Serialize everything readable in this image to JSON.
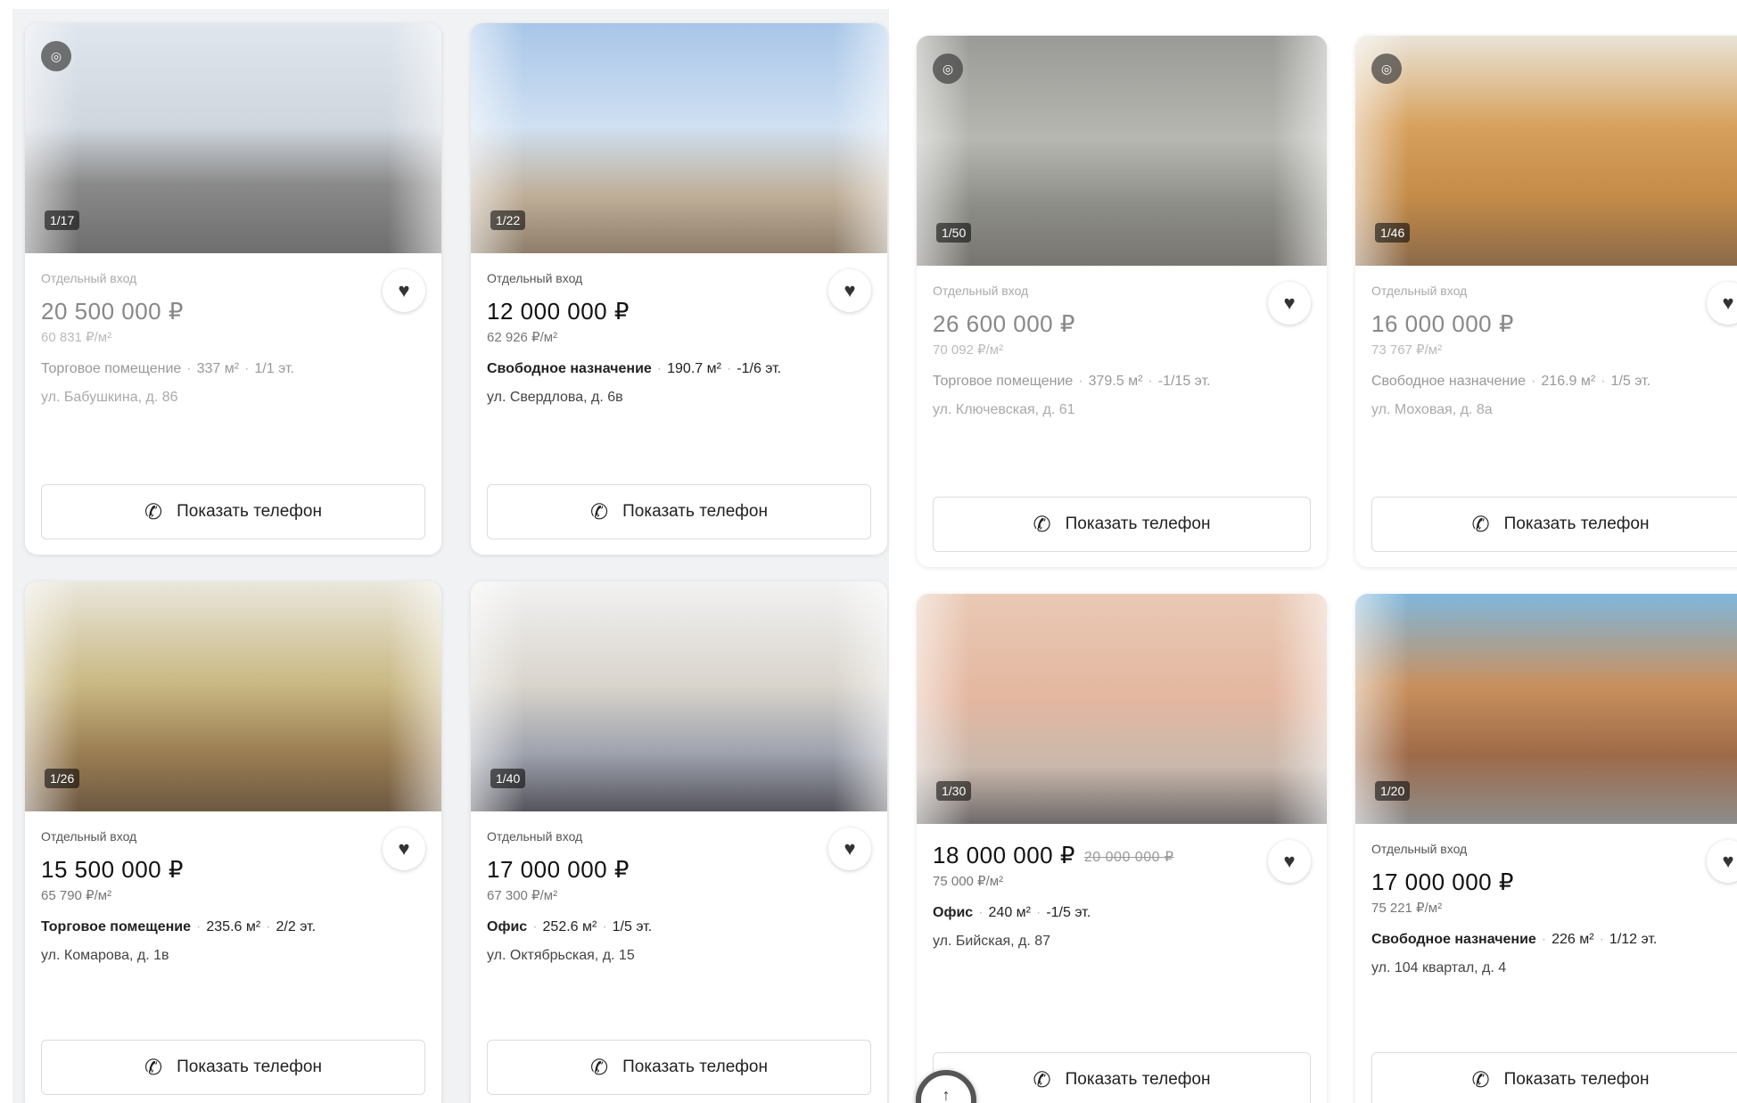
{
  "listings": [
    {
      "counter": "1/17",
      "tag": "Отдельный вход",
      "price": "20 500 000 ₽",
      "old_price": "",
      "ppm": "60 831 ₽/м²",
      "type": "Торговое помещение",
      "area": "337 м²",
      "floor": "1/1 эт.",
      "address": "ул. Бабушкина, д. 86",
      "phone": "Показать телефон"
    },
    {
      "counter": "1/22",
      "tag": "Отдельный вход",
      "price": "12 000 000 ₽",
      "old_price": "",
      "ppm": "62 926 ₽/м²",
      "type": "Свободное назначение",
      "area": "190.7 м²",
      "floor": "-1/6 эт.",
      "address": "ул. Свердлова, д. 6в",
      "phone": "Показать телефон"
    },
    {
      "counter": "1/50",
      "tag": "Отдельный вход",
      "price": "26 600 000 ₽",
      "old_price": "",
      "ppm": "70 092 ₽/м²",
      "type": "Торговое помещение",
      "area": "379.5 м²",
      "floor": "-1/15 эт.",
      "address": "ул. Ключевская, д. 61",
      "phone": "Показать телефон"
    },
    {
      "counter": "1/46",
      "tag": "Отдельный вход",
      "price": "16 000 000 ₽",
      "old_price": "",
      "ppm": "73 767 ₽/м²",
      "type": "Свободное назначение",
      "area": "216.9 м²",
      "floor": "1/5 эт.",
      "address": "ул. Моховая, д. 8а",
      "phone": "Показать телефон"
    },
    {
      "counter": "1/26",
      "tag": "Отдельный вход",
      "price": "15 500 000 ₽",
      "old_price": "",
      "ppm": "65 790 ₽/м²",
      "type": "Торговое помещение",
      "area": "235.6 м²",
      "floor": "2/2 эт.",
      "address": "ул. Комарова, д. 1в",
      "phone": "Показать телефон"
    },
    {
      "counter": "1/40",
      "tag": "Отдельный вход",
      "price": "17 000 000 ₽",
      "old_price": "",
      "ppm": "67 300 ₽/м²",
      "type": "Офис",
      "area": "252.6 м²",
      "floor": "1/5 эт.",
      "address": "ул. Октябрьская, д. 15",
      "phone": "Показать телефон"
    },
    {
      "counter": "1/30",
      "tag": "",
      "price": "18 000 000 ₽",
      "old_price": "20 000 000 ₽",
      "ppm": "75 000 ₽/м²",
      "type": "Офис",
      "area": "240 м²",
      "floor": "-1/5 эт.",
      "address": "ул. Бийская, д. 87",
      "phone": "Показать телефон"
    },
    {
      "counter": "1/20",
      "tag": "Отдельный вход",
      "price": "17 000 000 ₽",
      "old_price": "",
      "ppm": "75 221 ₽/м²",
      "type": "Свободное назначение",
      "area": "226 м²",
      "floor": "1/12 эт.",
      "address": "ул. 104 квартал, д. 4",
      "phone": "Показать телефон"
    }
  ],
  "icons": {
    "favorite": "heart-icon",
    "phone": "phone-icon",
    "panorama": "panorama-icon",
    "scroll_top": "arrow-up-icon"
  },
  "colors": {
    "price_text": "#111111",
    "muted_text": "#777777",
    "card_bg": "#ffffff",
    "panel_bg": "#f1f2f4"
  }
}
